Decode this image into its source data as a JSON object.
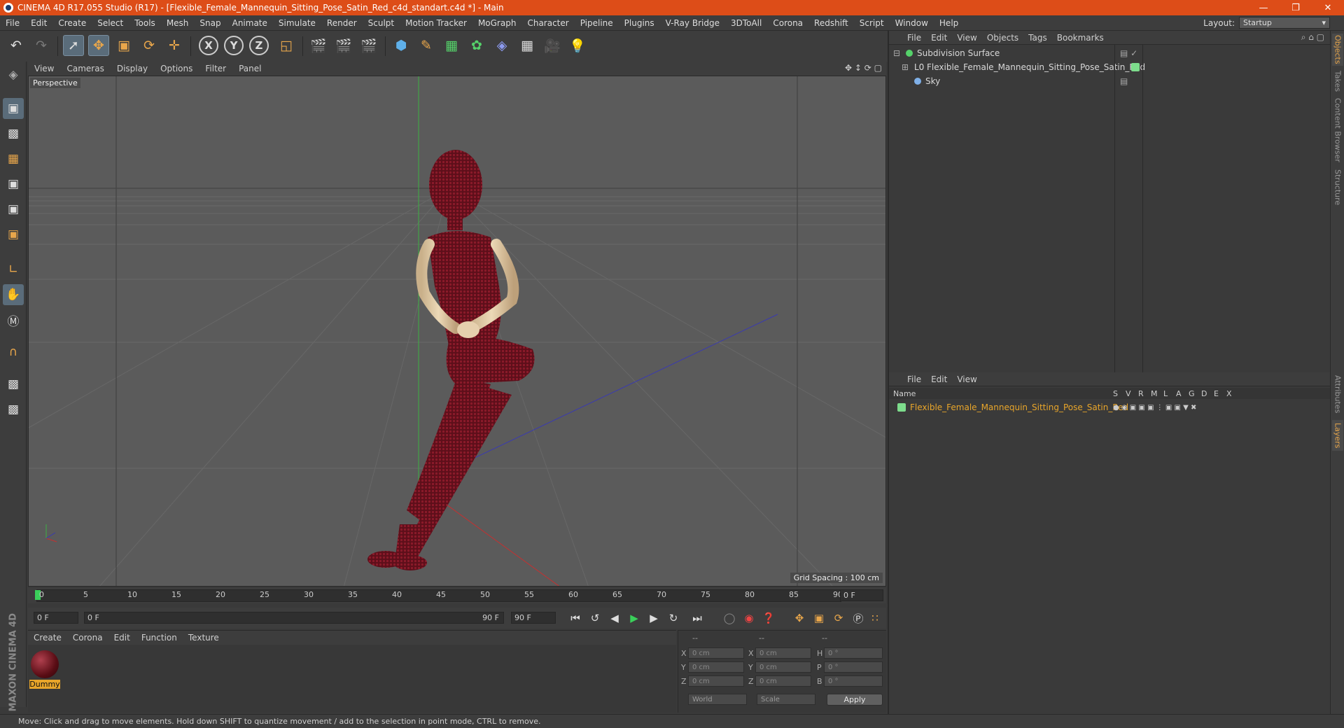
{
  "window": {
    "title": "CINEMA 4D R17.055 Studio (R17) - [Flexible_Female_Mannequin_Sitting_Pose_Satin_Red_c4d_standart.c4d *] - Main"
  },
  "menubar": {
    "items": [
      "File",
      "Edit",
      "Create",
      "Select",
      "Tools",
      "Mesh",
      "Snap",
      "Animate",
      "Simulate",
      "Render",
      "Sculpt",
      "Motion Tracker",
      "MoGraph",
      "Character",
      "Pipeline",
      "Plugins",
      "V-Ray Bridge",
      "3DToAll",
      "Corona",
      "Redshift",
      "Script",
      "Window",
      "Help"
    ]
  },
  "layout": {
    "label": "Layout:",
    "value": "Startup"
  },
  "viewport": {
    "menu": [
      "View",
      "Cameras",
      "Display",
      "Options",
      "Filter",
      "Panel"
    ],
    "label": "Perspective",
    "grid_spacing": "Grid Spacing : 100 cm"
  },
  "timeline": {
    "ticks": [
      "0",
      "5",
      "10",
      "15",
      "20",
      "25",
      "30",
      "35",
      "40",
      "45",
      "50",
      "55",
      "60",
      "65",
      "70",
      "75",
      "80",
      "85",
      "90"
    ],
    "end_field": "0 F"
  },
  "transport": {
    "start": "0 F",
    "range_start": "0 F",
    "range_end": "90 F",
    "end": "90 F"
  },
  "materials": {
    "menu": [
      "Create",
      "Corona",
      "Edit",
      "Function",
      "Texture"
    ],
    "items": [
      {
        "name": "Dummy"
      }
    ]
  },
  "coords": {
    "header": [
      "--",
      "--",
      "--"
    ],
    "rows": [
      {
        "a": "X",
        "av": "0 cm",
        "b": "X",
        "bv": "0 cm",
        "c": "H",
        "cv": "0 °"
      },
      {
        "a": "Y",
        "av": "0 cm",
        "b": "Y",
        "bv": "0 cm",
        "c": "P",
        "cv": "0 °"
      },
      {
        "a": "Z",
        "av": "0 cm",
        "b": "Z",
        "bv": "0 cm",
        "c": "B",
        "cv": "0 °"
      }
    ],
    "world": "World",
    "scale": "Scale",
    "apply": "Apply"
  },
  "objects": {
    "menu": [
      "File",
      "Edit",
      "View",
      "Objects",
      "Tags",
      "Bookmarks"
    ],
    "items": [
      {
        "name": "Subdivision Surface",
        "color": "#d8d8d8"
      },
      {
        "name": "Flexible_Female_Mannequin_Sitting_Pose_Satin_Red",
        "color": "#d8d8d8"
      },
      {
        "name": "Sky",
        "color": "#d8d8d8"
      }
    ]
  },
  "layers": {
    "menu": [
      "File",
      "Edit",
      "View"
    ],
    "header": {
      "name": "Name",
      "cols": [
        "S",
        "V",
        "R",
        "M",
        "L",
        "A",
        "G",
        "D",
        "E",
        "X"
      ]
    },
    "items": [
      {
        "name": "Flexible_Female_Mannequin_Sitting_Pose_Satin_Red",
        "color": "#e8a52a"
      }
    ]
  },
  "sidetabs": [
    "Objects",
    "Takes",
    "Content Browser",
    "Structure",
    "Attributes",
    "Layers"
  ],
  "status": {
    "text": "Move: Click and drag to move elements. Hold down SHIFT to quantize movement / add to the selection in point mode, CTRL to remove."
  },
  "brand": {
    "text": "MAXON CINEMA 4D"
  },
  "colors": {
    "accent": "#e8a64b",
    "title_bar": "#dd4d18",
    "layer_green": "#7ddc8c",
    "mannequin_red": "#7a1320"
  }
}
